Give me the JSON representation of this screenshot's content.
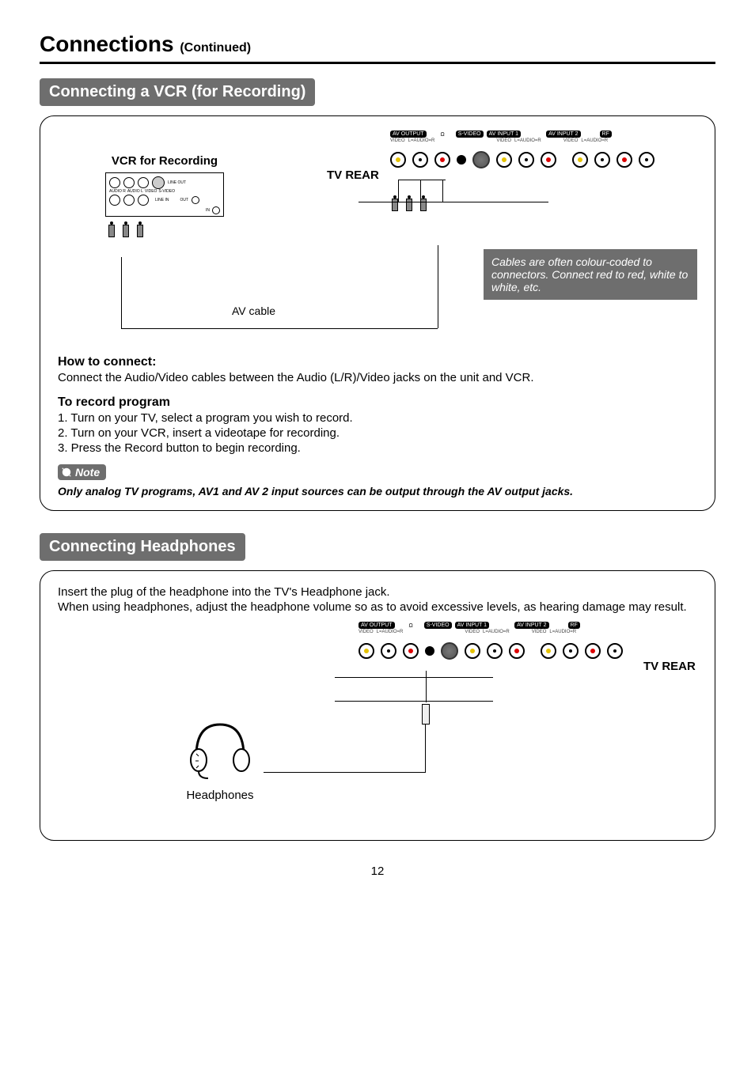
{
  "page": {
    "title": "Connections",
    "continued": "(Continued)"
  },
  "section1": {
    "header": "Connecting a VCR (for Recording)",
    "vcr_label": "VCR for Recording",
    "tv_rear": "TV REAR",
    "av_cable": "AV cable",
    "info_box": "Cables are often colour-coded to connectors. Connect red to red, white to white, etc.",
    "howto_title": "How to connect:",
    "howto_text": "Connect the Audio/Video cables between the Audio (L/R)/Video jacks on the unit and VCR.",
    "record_title": "To record program",
    "step1": "1. Turn on your TV, select a program you wish to record.",
    "step2": "2. Turn on your VCR, insert a videotape for recording.",
    "step3": "3. Press the Record button to begin recording.",
    "note_badge": "Note",
    "note_text": "Only analog TV programs, AV1  and AV 2 input sources can be output through the AV output jacks.",
    "panel": {
      "av_output": "AV OUTPUT",
      "video": "VIDEO",
      "l_audio_r": "L=AUDIO=R",
      "hp": "Ω",
      "s_video": "S-VIDEO",
      "av_input1": "AV INPUT 1",
      "av_input2": "AV INPUT 2",
      "rf": "RF",
      "line_out": "LINE OUT",
      "line_in": "LINE IN",
      "audio_r": "AUDIO R",
      "audio_l": "AUDIO L",
      "out": "OUT",
      "in": "IN"
    }
  },
  "section2": {
    "header": "Connecting Headphones",
    "text1": "Insert the plug of the headphone into the TV's Headphone jack.",
    "text2": "When using headphones, adjust the headphone volume so as to avoid excessive levels, as hearing damage may result.",
    "tv_rear": "TV REAR",
    "hp_label": "Headphones"
  },
  "page_number": "12"
}
